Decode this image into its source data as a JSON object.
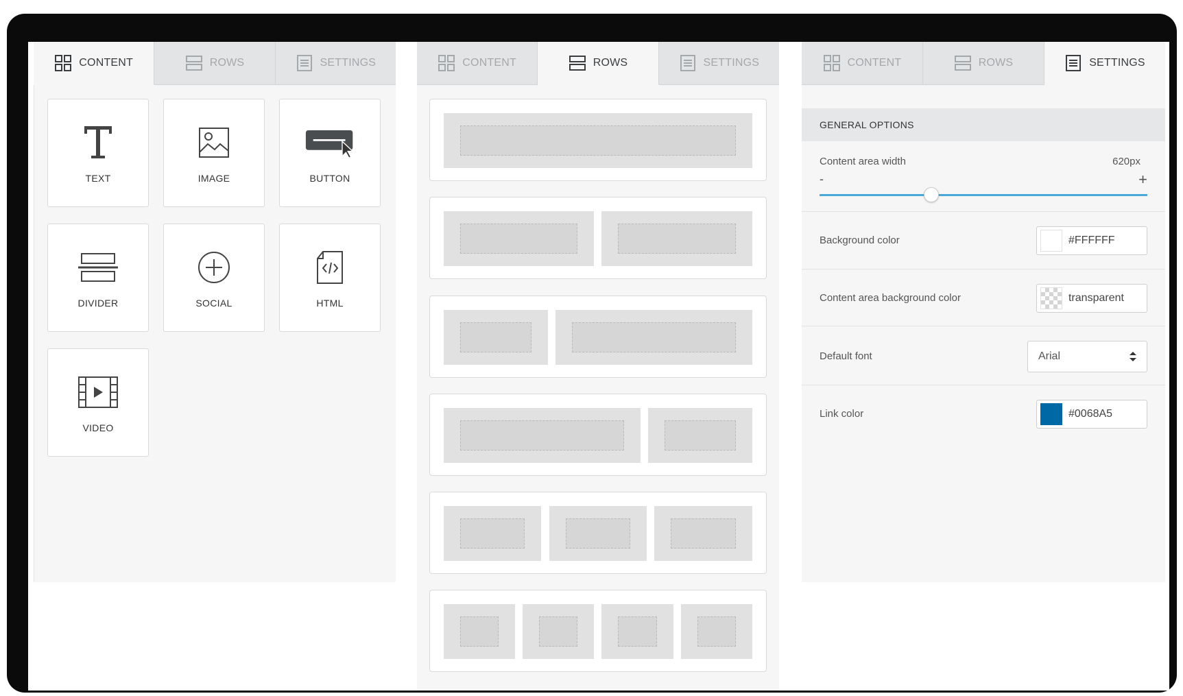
{
  "tabs": {
    "content": "CONTENT",
    "rows": "ROWS",
    "settings": "SETTINGS"
  },
  "content_blocks": [
    {
      "label": "TEXT",
      "icon": "text-icon"
    },
    {
      "label": "IMAGE",
      "icon": "image-icon"
    },
    {
      "label": "BUTTON",
      "icon": "button-icon"
    },
    {
      "label": "DIVIDER",
      "icon": "divider-icon"
    },
    {
      "label": "SOCIAL",
      "icon": "social-icon"
    },
    {
      "label": "HTML",
      "icon": "html-icon"
    },
    {
      "label": "VIDEO",
      "icon": "video-icon"
    }
  ],
  "rows": [
    {
      "columns": 1
    },
    {
      "columns": 2
    },
    {
      "columns": 2
    },
    {
      "columns": 2
    },
    {
      "columns": 3
    },
    {
      "columns": 4
    }
  ],
  "settings": {
    "section_title": "GENERAL OPTIONS",
    "content_width": {
      "label": "Content area width",
      "value": "620px",
      "minus": "-",
      "plus": "+",
      "slider_fraction": 0.34
    },
    "background_color": {
      "label": "Background color",
      "value": "#FFFFFF",
      "swatch": "#FFFFFF"
    },
    "content_bg_color": {
      "label": "Content area background color",
      "value": "transparent"
    },
    "default_font": {
      "label": "Default font",
      "value": "Arial"
    },
    "link_color": {
      "label": "Link color",
      "value": "#0068A5",
      "swatch": "#0068A5"
    }
  },
  "colors": {
    "accent": "#4aa8d8",
    "tab_inactive": "#e3e4e5",
    "panel_bg": "#f6f6f6"
  }
}
